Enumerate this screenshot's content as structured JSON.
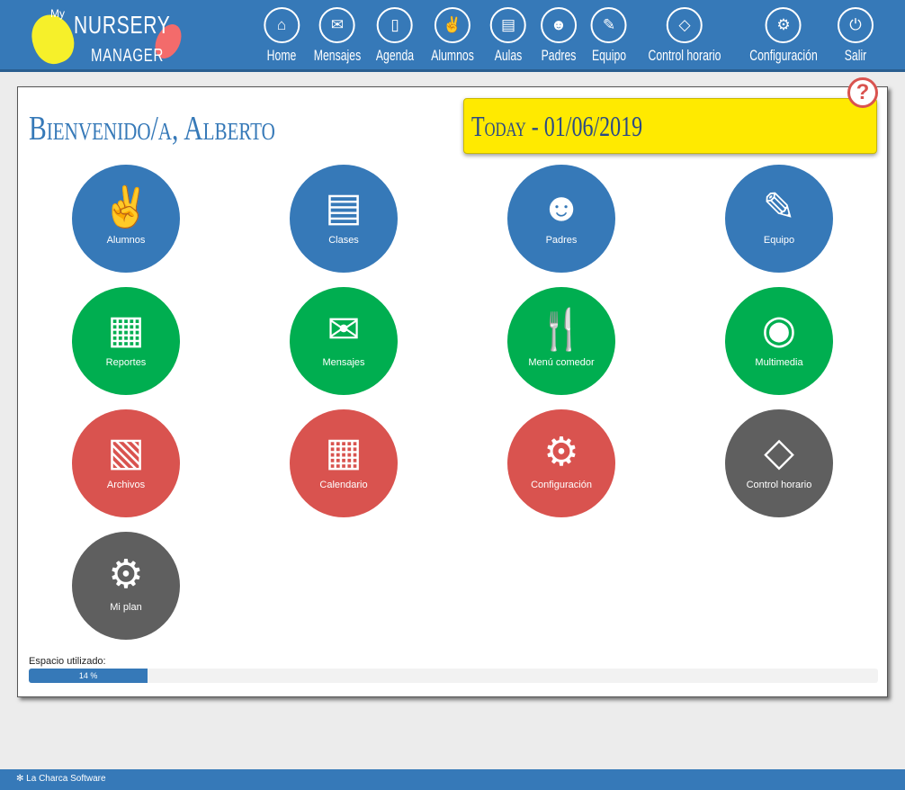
{
  "app": {
    "logo_my": "My",
    "logo_nursery": "NURSERY",
    "logo_manager": "MANAGER"
  },
  "nav": [
    {
      "label": "Home",
      "icon": "home-icon",
      "glyph": "⌂"
    },
    {
      "label": "Mensajes",
      "icon": "envelope-icon",
      "glyph": "✉"
    },
    {
      "label": "Agenda",
      "icon": "mobile-icon",
      "glyph": "▯"
    },
    {
      "label": "Alumnos",
      "icon": "child-icon",
      "glyph": "✌"
    },
    {
      "label": "Aulas",
      "icon": "book-icon",
      "glyph": "▤"
    },
    {
      "label": "Padres",
      "icon": "users-icon",
      "glyph": "☻"
    },
    {
      "label": "Equipo",
      "icon": "brush-icon",
      "glyph": "✎"
    },
    {
      "label": "Control horario",
      "icon": "ticket-icon",
      "glyph": "◇"
    },
    {
      "label": "Configuración",
      "icon": "cogs-icon",
      "glyph": "⚙"
    },
    {
      "label": "Salir",
      "icon": "power-icon",
      "glyph": "⏻"
    }
  ],
  "welcome": "Bienvenido/a, Alberto",
  "today": "Today - 01/06/2019",
  "help_glyph": "?",
  "colors": {
    "blue": "#3679b8",
    "green": "#00ae50",
    "red": "#d9534f",
    "gray": "#5f5f5f",
    "yellow": "#ffea00"
  },
  "tiles": [
    {
      "label": "Alumnos",
      "icon": "child-icon",
      "glyph": "✌",
      "color": "#3679b8"
    },
    {
      "label": "Clases",
      "icon": "book-icon",
      "glyph": "▤",
      "color": "#3679b8"
    },
    {
      "label": "Padres",
      "icon": "users-icon",
      "glyph": "☻",
      "color": "#3679b8"
    },
    {
      "label": "Equipo",
      "icon": "brush-icon",
      "glyph": "✎",
      "color": "#3679b8"
    },
    {
      "label": "Reportes",
      "icon": "document-icon",
      "glyph": "▦",
      "color": "#00ae50"
    },
    {
      "label": "Mensajes",
      "icon": "envelope-icon",
      "glyph": "✉",
      "color": "#00ae50"
    },
    {
      "label": "Menú comedor",
      "icon": "utensils-icon",
      "glyph": "🍴",
      "color": "#00ae50"
    },
    {
      "label": "Multimedia",
      "icon": "camera-icon",
      "glyph": "◉",
      "color": "#00ae50"
    },
    {
      "label": "Archivos",
      "icon": "pdf-file-icon",
      "glyph": "▧",
      "color": "#d9534f"
    },
    {
      "label": "Calendario",
      "icon": "calendar-icon",
      "glyph": "▦",
      "color": "#d9534f"
    },
    {
      "label": "Configuración",
      "icon": "cogs-icon",
      "glyph": "⚙",
      "color": "#d9534f"
    },
    {
      "label": "Control horario",
      "icon": "ticket-icon",
      "glyph": "◇",
      "color": "#5f5f5f"
    },
    {
      "label": "Mi plan",
      "icon": "cogs-icon",
      "glyph": "⚙",
      "color": "#5f5f5f"
    }
  ],
  "usage": {
    "label": "Espacio utilizado:",
    "percent": 14,
    "text": "14 %"
  },
  "footer": "La Charca Software"
}
